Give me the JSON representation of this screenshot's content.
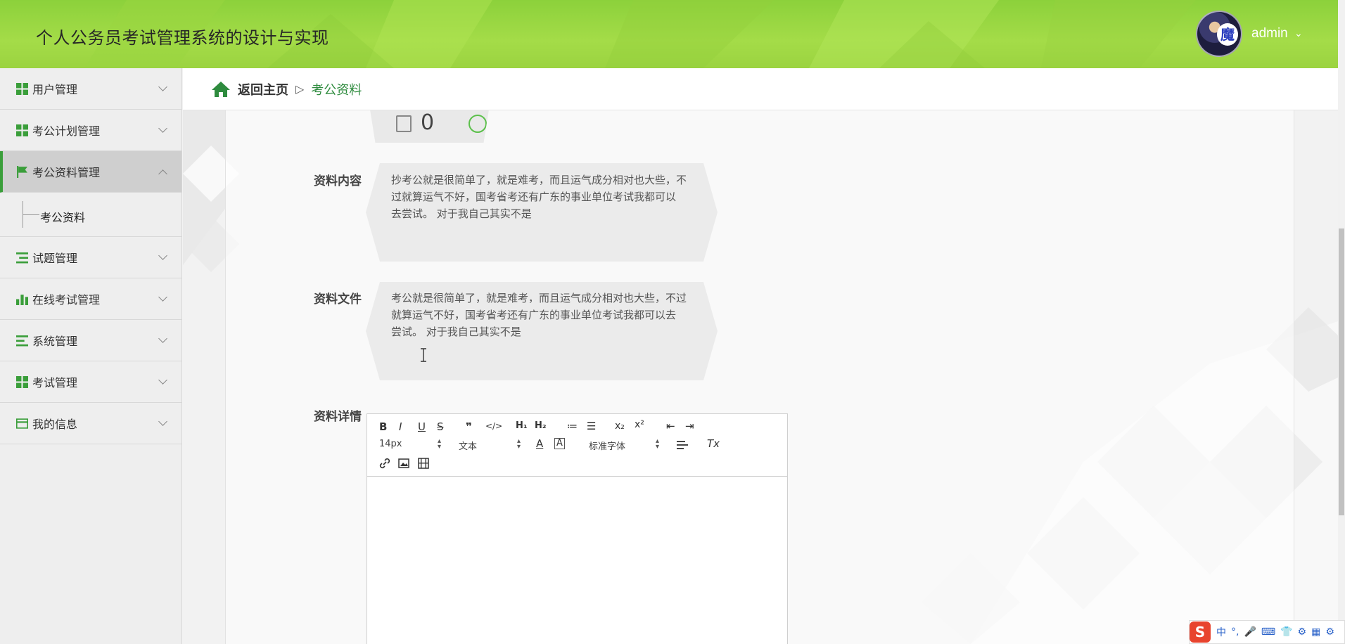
{
  "header": {
    "title": "个人公务员考试管理系统的设计与实现",
    "avatar_badge": "魔",
    "user": "admin",
    "user_caret": "⌄"
  },
  "sidebar": {
    "items": [
      {
        "label": "用户管理",
        "icon": "grid-icon"
      },
      {
        "label": "考公计划管理",
        "icon": "grid-icon"
      },
      {
        "label": "考公资料管理",
        "icon": "flag-icon",
        "active": true
      },
      {
        "label": "试题管理",
        "icon": "list-icon"
      },
      {
        "label": "在线考试管理",
        "icon": "bar-chart-icon"
      },
      {
        "label": "系统管理",
        "icon": "menu-icon"
      },
      {
        "label": "考试管理",
        "icon": "grid-icon"
      },
      {
        "label": "我的信息",
        "icon": "card-icon"
      }
    ],
    "submenu": {
      "label": "考公资料"
    }
  },
  "breadcrumb": {
    "home": "返回主页",
    "separator": "▷",
    "current": "考公资料"
  },
  "form": {
    "partial_value": "0",
    "content_label": "资料内容",
    "content_text_line1": "抄考公就是很简单了，就是难考，而且运气成分相对也大些，不",
    "content_text_line2": "过就算运气不好，国考省考还有广东的事业单位考试我都可以",
    "content_text_line3": "去尝试。  对于我自己其实不是",
    "file_label": "资料文件",
    "file_text_line1": "考公就是很简单了，就是难考，而且运气成分相对也大些，不过",
    "file_text_line2": "就算运气不好，国考省考还有广东的事业单位考试我都可以去",
    "file_text_line3": "尝试。  对于我自己其实不是",
    "detail_label": "资料详情"
  },
  "editor": {
    "toolbar": {
      "bold": "B",
      "italic": "I",
      "underline": "U",
      "strike": "S",
      "quote": "❞",
      "code": "</>",
      "h1": "H₁",
      "h2": "H₂",
      "ol": "≔",
      "ul": "☰",
      "sub": "x₂",
      "sup": "x²",
      "outdent": "⇤",
      "indent": "⇥",
      "size": "14px",
      "format": "文本",
      "font": "标准字体",
      "color": "A",
      "clean": "Tx"
    }
  },
  "ime": {
    "logo": "S",
    "items": [
      "中",
      "°,",
      "🎤",
      "⌨",
      "👕",
      "⚙",
      "▦",
      "⚙"
    ]
  },
  "colors": {
    "header_green": "#a4dc48",
    "accent_green": "#2e8b3e",
    "icon_green": "#3a9e3a"
  }
}
